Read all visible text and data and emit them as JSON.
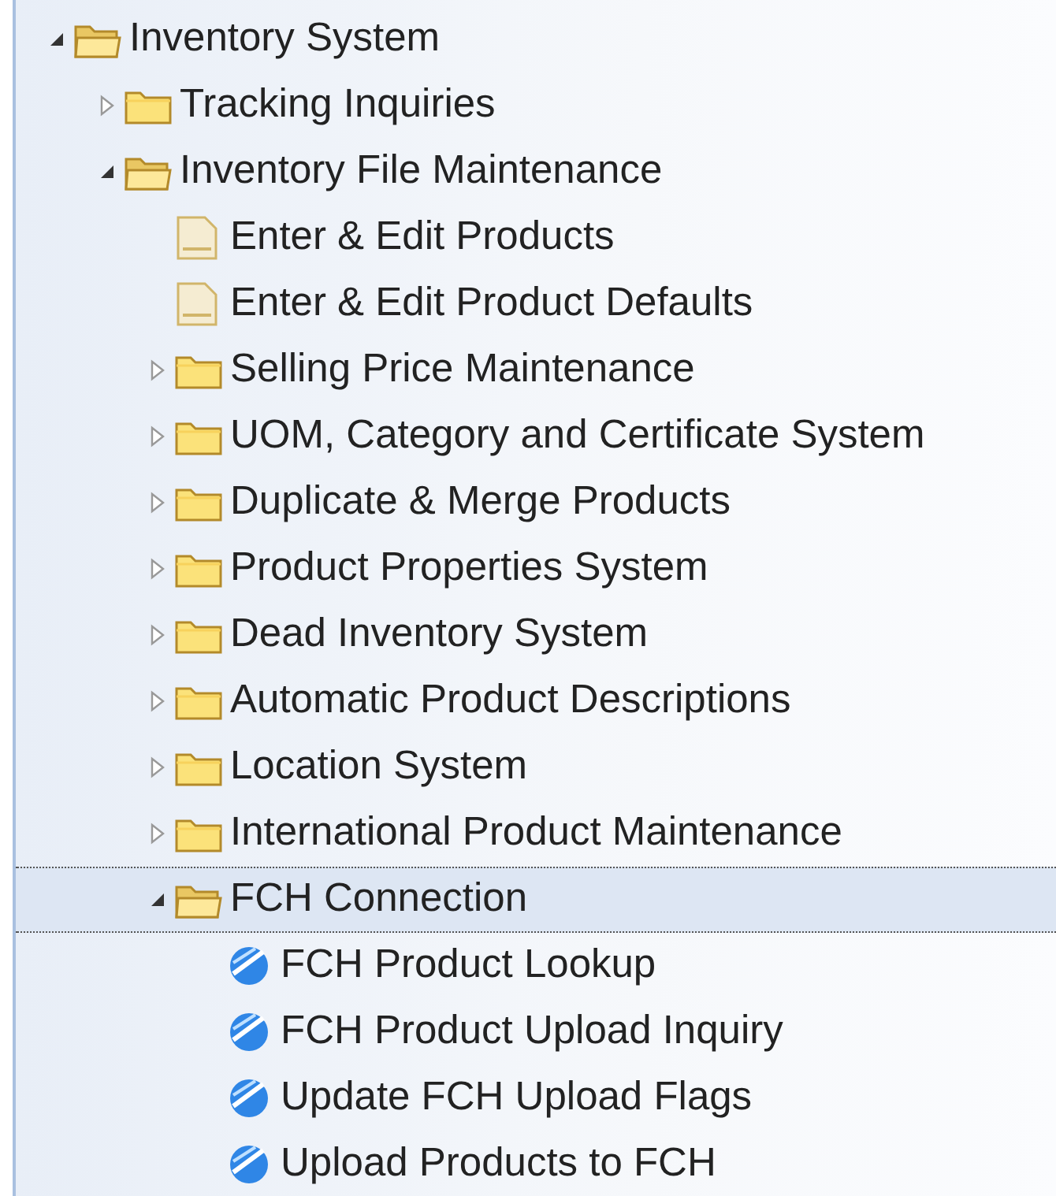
{
  "tree": [
    {
      "kind": "folder",
      "label": "Inventory System",
      "expanded": true,
      "selected": false,
      "children": [
        {
          "kind": "folder",
          "label": "Tracking Inquiries",
          "expanded": false,
          "selected": false
        },
        {
          "kind": "folder",
          "label": "Inventory File Maintenance",
          "expanded": true,
          "selected": false,
          "children": [
            {
              "kind": "document",
              "label": "Enter & Edit Products",
              "selected": false
            },
            {
              "kind": "document",
              "label": "Enter & Edit Product Defaults",
              "selected": false
            },
            {
              "kind": "folder",
              "label": "Selling Price Maintenance",
              "expanded": false,
              "selected": false
            },
            {
              "kind": "folder",
              "label": "UOM, Category and Certificate System",
              "expanded": false,
              "selected": false
            },
            {
              "kind": "folder",
              "label": "Duplicate & Merge Products",
              "expanded": false,
              "selected": false
            },
            {
              "kind": "folder",
              "label": "Product Properties System",
              "expanded": false,
              "selected": false
            },
            {
              "kind": "folder",
              "label": "Dead Inventory System",
              "expanded": false,
              "selected": false
            },
            {
              "kind": "folder",
              "label": "Automatic Product Descriptions",
              "expanded": false,
              "selected": false
            },
            {
              "kind": "folder",
              "label": "Location System",
              "expanded": false,
              "selected": false
            },
            {
              "kind": "folder",
              "label": "International Product Maintenance",
              "expanded": false,
              "selected": false
            },
            {
              "kind": "folder",
              "label": "FCH Connection",
              "expanded": true,
              "selected": true,
              "children": [
                {
                  "kind": "link",
                  "label": "FCH Product Lookup",
                  "selected": false
                },
                {
                  "kind": "link",
                  "label": "FCH Product Upload Inquiry",
                  "selected": false
                },
                {
                  "kind": "link",
                  "label": "Update FCH Upload Flags",
                  "selected": false
                },
                {
                  "kind": "link",
                  "label": "Upload Products to FCH",
                  "selected": false
                }
              ]
            }
          ]
        }
      ]
    }
  ]
}
